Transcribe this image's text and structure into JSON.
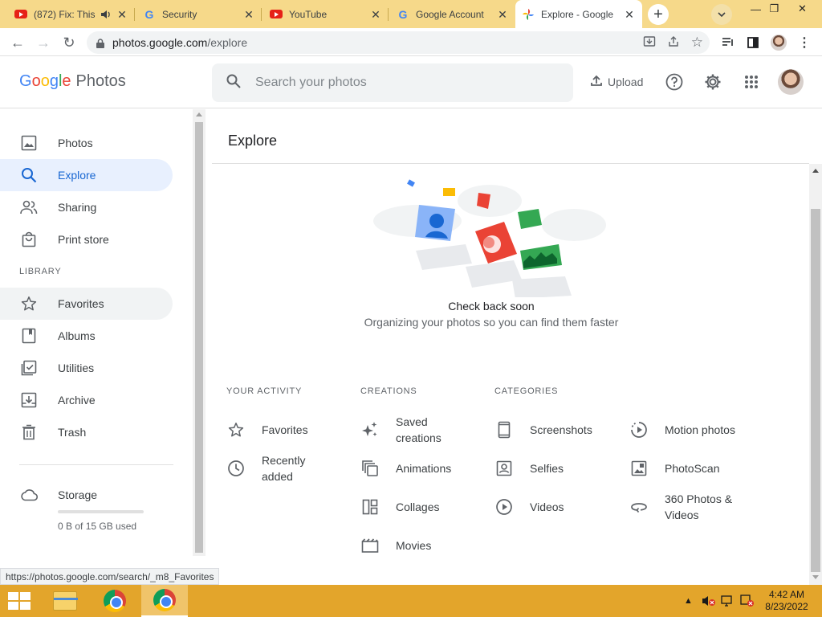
{
  "browser": {
    "tabs": [
      {
        "title": "(872) Fix: This",
        "favicon": "youtube-icon",
        "active": false
      },
      {
        "title": "Security",
        "favicon": "google-icon",
        "active": false
      },
      {
        "title": "YouTube",
        "favicon": "youtube-icon",
        "active": false
      },
      {
        "title": "Google Account",
        "favicon": "google-icon",
        "active": false
      },
      {
        "title": "Explore - Google",
        "favicon": "google-photos-icon",
        "active": true
      }
    ],
    "url_host": "photos.google.com",
    "url_path": "/explore",
    "status_url": "https://photos.google.com/search/_m8_Favorites"
  },
  "header": {
    "logo_google": [
      "G",
      "o",
      "o",
      "g",
      "l",
      "e"
    ],
    "logo_photos": "Photos",
    "search_placeholder": "Search your photos",
    "upload_label": "Upload"
  },
  "sidebar": {
    "items": [
      {
        "label": "Photos",
        "icon": "photo-icon"
      },
      {
        "label": "Explore",
        "icon": "search-icon",
        "active": true
      },
      {
        "label": "Sharing",
        "icon": "people-icon"
      },
      {
        "label": "Print store",
        "icon": "bag-icon"
      }
    ],
    "library_label": "LIBRARY",
    "library_items": [
      {
        "label": "Favorites",
        "icon": "star-icon"
      },
      {
        "label": "Albums",
        "icon": "album-icon"
      },
      {
        "label": "Utilities",
        "icon": "checkbox-icon"
      },
      {
        "label": "Archive",
        "icon": "archive-icon"
      },
      {
        "label": "Trash",
        "icon": "trash-icon"
      }
    ],
    "storage_label": "Storage",
    "storage_text": "0 B of 15 GB used",
    "storage_used_fraction": 0
  },
  "main": {
    "title": "Explore",
    "empty_title": "Check back soon",
    "empty_subtitle": "Organizing your photos so you can find them faster",
    "sections": {
      "activity": {
        "heading": "YOUR ACTIVITY",
        "items": [
          {
            "label1": "Favorites",
            "label2": "",
            "icon": "star-icon"
          },
          {
            "label1": "Recently",
            "label2": "added",
            "icon": "clock-icon"
          }
        ]
      },
      "creations": {
        "heading": "CREATIONS",
        "items": [
          {
            "label1": "Saved",
            "label2": "creations",
            "icon": "sparkle-icon"
          },
          {
            "label1": "Animations",
            "label2": "",
            "icon": "animation-icon"
          },
          {
            "label1": "Collages",
            "label2": "",
            "icon": "collage-icon"
          },
          {
            "label1": "Movies",
            "label2": "",
            "icon": "movie-icon"
          }
        ]
      },
      "categories": {
        "heading": "CATEGORIES",
        "items": [
          {
            "label1": "Screenshots",
            "label2": "",
            "icon": "phone-icon"
          },
          {
            "label1": "Selfies",
            "label2": "",
            "icon": "selfie-icon"
          },
          {
            "label1": "Videos",
            "label2": "",
            "icon": "play-icon"
          },
          {
            "label1": "Motion photos",
            "label2": "",
            "icon": "motion-icon"
          },
          {
            "label1": "PhotoScan",
            "label2": "",
            "icon": "photoscan-icon"
          },
          {
            "label1": "360 Photos &",
            "label2": "Videos",
            "icon": "360-icon"
          }
        ]
      }
    }
  },
  "taskbar": {
    "time": "4:42 AM",
    "date": "8/23/2022"
  }
}
